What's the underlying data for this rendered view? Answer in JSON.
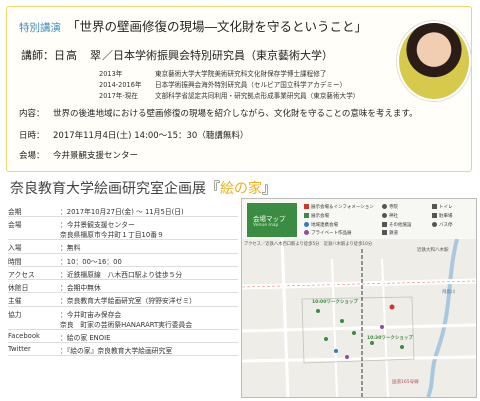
{
  "lecture": {
    "tag": "特別講演",
    "title": "「世界の壁画修復の現場―文化財を守るということ」",
    "speaker_label": "講師：",
    "speaker_name": "日高　翠",
    "speaker_title": "／日本学術振興会特別研究員（東京藝術大学）",
    "career": [
      {
        "year": "2013年",
        "text": "東京藝術大学大学院美術研究科文化財保存学博士課程修了"
      },
      {
        "year": "2014-2016年",
        "text": "日本学術振興会海外特別研究員（セルビア国立科学アカデミー）"
      },
      {
        "year": "2017年-現在",
        "text": "文部科学省認定共同利用・研究拠点形成事業研究員（東京藝術大学）"
      }
    ],
    "content_label": "内容：",
    "content": "世界の後進地域における壁画修復の現場を紹介しながら、文化財を守ることの意味を考えます。",
    "date_label": "日時：",
    "date": "2017年11月4日(土) 14:00～15：30（聴講無料）",
    "venue_label": "会場：",
    "venue": "今井景観支援センター"
  },
  "exhibition": {
    "title_prefix": "奈良教育大学絵画研究室企画展『",
    "title_highlight": "絵の家",
    "title_suffix": "』"
  },
  "schedule": [
    {
      "label": "会期",
      "value": "：2017年10月27日(金) ～ 11月5日(日)"
    },
    {
      "label": "会場",
      "value": "：今井景観支援センター",
      "value2": "奈良県橿原市今井町１丁目10番９"
    },
    {
      "label": "入場",
      "value": "：無料"
    },
    {
      "label": "時間",
      "value": "：10：00～16：00"
    },
    {
      "label": "アクセス",
      "value": "：近鉄橿原線　八木西口駅より徒歩５分"
    },
    {
      "label": "休館日",
      "value": "：会期中無休"
    },
    {
      "label": "主催",
      "value": "：奈良教育大学絵画研究室（狩野安洋ゼミ）"
    },
    {
      "label": "協力",
      "value": "：今井町宙み保存会",
      "value2": "奈良　町家の芸術祭HANARART実行委員会"
    },
    {
      "label": "Facebook",
      "value": "：絵の家 ENOIE"
    },
    {
      "label": "Twitter",
      "value": "：『絵の家』奈良教育大学絵画研究室"
    }
  ],
  "map": {
    "badge_title": "会場マップ",
    "badge_sub": "Venue map",
    "legend": [
      {
        "text": "展示会場＆インフォメーション",
        "color": "#d0342c"
      },
      {
        "text": "寺院",
        "color": "#555555"
      },
      {
        "text": "トイレ",
        "color": "#555555"
      },
      {
        "text": "展示会場",
        "color": "#3b8c43"
      },
      {
        "text": "神社",
        "color": "#555555"
      },
      {
        "text": "駐車場",
        "color": "#555555"
      },
      {
        "text": "地域連携会場",
        "color": "#2d7fb8"
      },
      {
        "text": "その他施設",
        "color": "#555555"
      },
      {
        "text": "プライベート作品展",
        "color": "#8b4fa3"
      },
      {
        "text": "鉄道",
        "color": "#555555"
      },
      {
        "text": "バス停",
        "color": "#555555"
      }
    ],
    "access_note": "アクセス／近鉄八木西口駅より徒歩5分　近鉄八木駅より徒歩10分",
    "workshop_label": "10:00ワークショップ",
    "workshop_label2": "10:30ワークショップ",
    "river": "飛鳥川",
    "station": "近鉄大和八木駅",
    "road": "国道165号線"
  }
}
